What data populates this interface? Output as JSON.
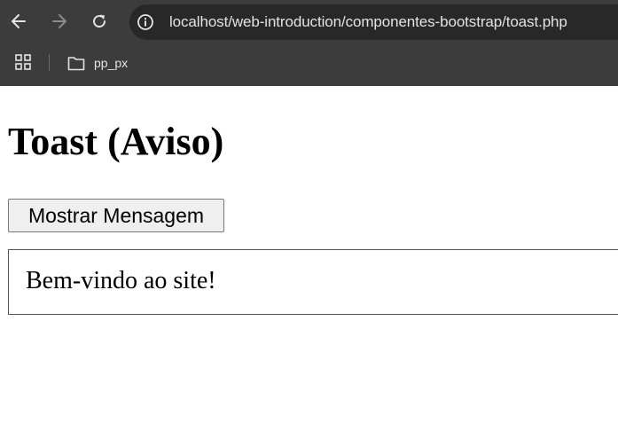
{
  "browser": {
    "url": "localhost/web-introduction/componentes-bootstrap/toast.php",
    "bookmarks": [
      {
        "label": "pp_px"
      }
    ],
    "icons": {
      "back": "back-arrow-icon",
      "forward": "forward-arrow-icon",
      "reload": "reload-icon",
      "site_info": "info-icon",
      "apps": "apps-grid-icon",
      "bookmark_folder": "folder-icon"
    }
  },
  "page": {
    "title": "Toast (Aviso)",
    "button_label": "Mostrar Mensagem",
    "toast_message": "Bem-vindo ao site!"
  },
  "colors": {
    "chrome_bg": "#3c3c3c",
    "address_bg": "#282828",
    "chrome_text": "#e3e3e3",
    "button_bg": "#efefef",
    "toast_border": "#555555"
  }
}
